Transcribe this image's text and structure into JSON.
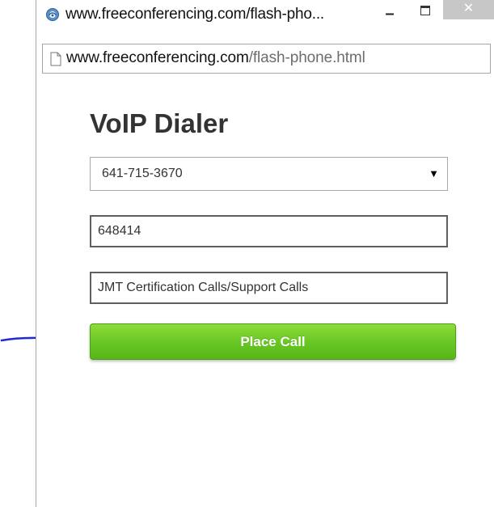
{
  "window": {
    "title": "www.freeconferencing.com/flash-pho...",
    "minimize_label": "–",
    "close_label": "✕"
  },
  "address_bar": {
    "domain": "www.freeconferencing.com",
    "path": "/flash-phone.html",
    "icon": "page-icon"
  },
  "dialer": {
    "title": "VoIP Dialer",
    "selected_number": "641-715-3670",
    "select_arrow": "▼",
    "access_code_value": "648414",
    "label_value": "JMT Certification Calls/Support Calls",
    "place_call_label": "Place Call",
    "button_color": "#69c824"
  },
  "annotation": {
    "icon": "arrow-icon",
    "color": "#1f2bd6"
  }
}
